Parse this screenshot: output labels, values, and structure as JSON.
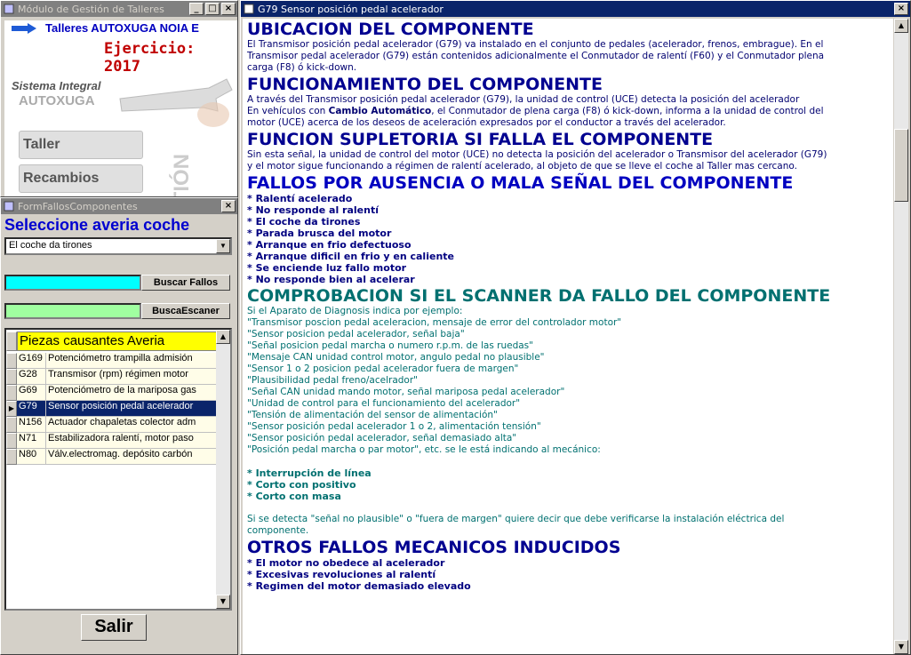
{
  "main_window": {
    "title": "Módulo de Gestión de Talleres",
    "company": "Talleres AUTOXUGA NOIA E",
    "ejercicio": "Ejercicio: 2017",
    "sistema": "Sistema Integral",
    "brand": "AUTOXUGA",
    "taller_label": "Taller",
    "recambios_label": "Recambios",
    "vertical_text": "TIÓN"
  },
  "form_window": {
    "title": "FormFallosComponentes",
    "select_title": "Seleccione averia coche",
    "combo_value": "El coche da tirones",
    "buscar_fallos_label": "Buscar Fallos",
    "busca_escaner_label": "BuscaEscaner",
    "grid_header": "Piezas causantes Averia",
    "rows": [
      {
        "code": "G169",
        "desc": "Potenciómetro trampilla admisión"
      },
      {
        "code": "G28",
        "desc": "Transmisor (rpm) régimen motor"
      },
      {
        "code": "G69",
        "desc": "Potenciómetro de la mariposa gas"
      },
      {
        "code": "G79",
        "desc": "Sensor posición pedal acelerador"
      },
      {
        "code": "N156",
        "desc": "Actuador chapaletas colector adm"
      },
      {
        "code": "N71",
        "desc": "Estabilizadora ralentí, motor paso"
      },
      {
        "code": "N80",
        "desc": "Válv.electromag. depósito carbón"
      }
    ],
    "selected_index": 3,
    "salir_label": "Salir"
  },
  "doc_window": {
    "title": "G79  Sensor posición pedal acelerador",
    "s1_title": "UBICACION DEL COMPONENTE",
    "s1_p1": "El Transmisor posición pedal acelerador (G79) va instalado en el conjunto de pedales (acelerador, frenos, embrague). En el",
    "s1_p2": "Transmisor pedal acelerador (G79) están contenidos adicionalmente el Conmutador de ralentí (F60) y el Conmutador plena",
    "s1_p3": "carga (F8) ó kick-down.",
    "s2_title": "FUNCIONAMIENTO DEL COMPONENTE",
    "s2_p1": "A través del Transmisor posición pedal acelerador (G79), la unidad de control (UCE) detecta la posición del acelerador",
    "s2_p2a": "En vehículos con ",
    "s2_p2b": "Cambio Automático",
    "s2_p2c": ", el Conmutador de plena carga (F8) ó kick-down, informa a la unidad de control del",
    "s2_p3": "motor (UCE) acerca de los deseos de aceleración expresados por el conductor a través del acelerador.",
    "s3_title": "FUNCION SUPLETORIA SI FALLA EL COMPONENTE",
    "s3_p1": "Sin esta señal, la unidad de control del motor (UCE) no detecta la posición del acelerador o Transmisor del acelerador (G79)",
    "s3_p2": "y el motor sigue funcionando a régimen de ralentí acelerado, al objeto de que se lleve el coche al Taller mas cercano.",
    "s4_title": "FALLOS POR AUSENCIA O MALA SEÑAL DEL COMPONENTE",
    "s4_items": [
      "* Ralentí acelerado",
      "* No responde al ralentí",
      "* El coche da tirones",
      "* Parada brusca del motor",
      "* Arranque en frio defectuoso",
      "* Arranque dificil en frio y en caliente",
      "* Se enciende luz fallo motor",
      "* No responde bien al acelerar"
    ],
    "s5_title": "COMPROBACION SI EL SCANNER DA FALLO DEL COMPONENTE",
    "s5_lines": [
      "Si el Aparato de Diagnosis indica por ejemplo:",
      "\"Transmisor poscion pedal aceleracion, mensaje de error del controlador motor\"",
      "\"Sensor posicion pedal acelerador, señal baja\"",
      "\"Señal posicion pedal marcha o numero r.p.m. de las ruedas\"",
      "\"Mensaje CAN unidad control motor, angulo pedal no plausible\"",
      "\"Sensor 1 o 2 posicion pedal acelerador fuera de margen\"",
      "\"Plausibilidad pedal freno/acelrador\"",
      "\"Señal CAN unidad mando motor, señal mariposa pedal acelerador\"",
      "\"Unidad de control para el funcionamiento del acelerador\"",
      "\"Tensión de alimentación del sensor de alimentación\"",
      "\"Sensor posición pedal acelerador 1 o 2, alimentación tensión\"",
      "\"Sensor posición pedal acelerador, señal demasiado alta\"",
      "\"Posición pedal marcha o par motor\", etc. se le está indicando al mecánico:"
    ],
    "s5_items": [
      "* Interrupción de línea",
      "* Corto con positivo",
      "* Corto con masa"
    ],
    "s5_note1": "Si se detecta \"señal no plausible\" o \"fuera de margen\" quiere decir que debe verificarse la instalación eléctrica del",
    "s5_note2": "componente.",
    "s6_title": "OTROS FALLOS MECANICOS INDUCIDOS",
    "s6_items": [
      "* El motor no obedece al acelerador",
      "* Excesivas revoluciones al ralentí",
      "* Regimen del motor demasiado elevado"
    ]
  },
  "colors": {
    "accent": "#000090",
    "teal": "#007070",
    "cyan_bar": "#00ffff",
    "green_bar": "#a0ffa0",
    "yellow_header": "#ffff00"
  }
}
